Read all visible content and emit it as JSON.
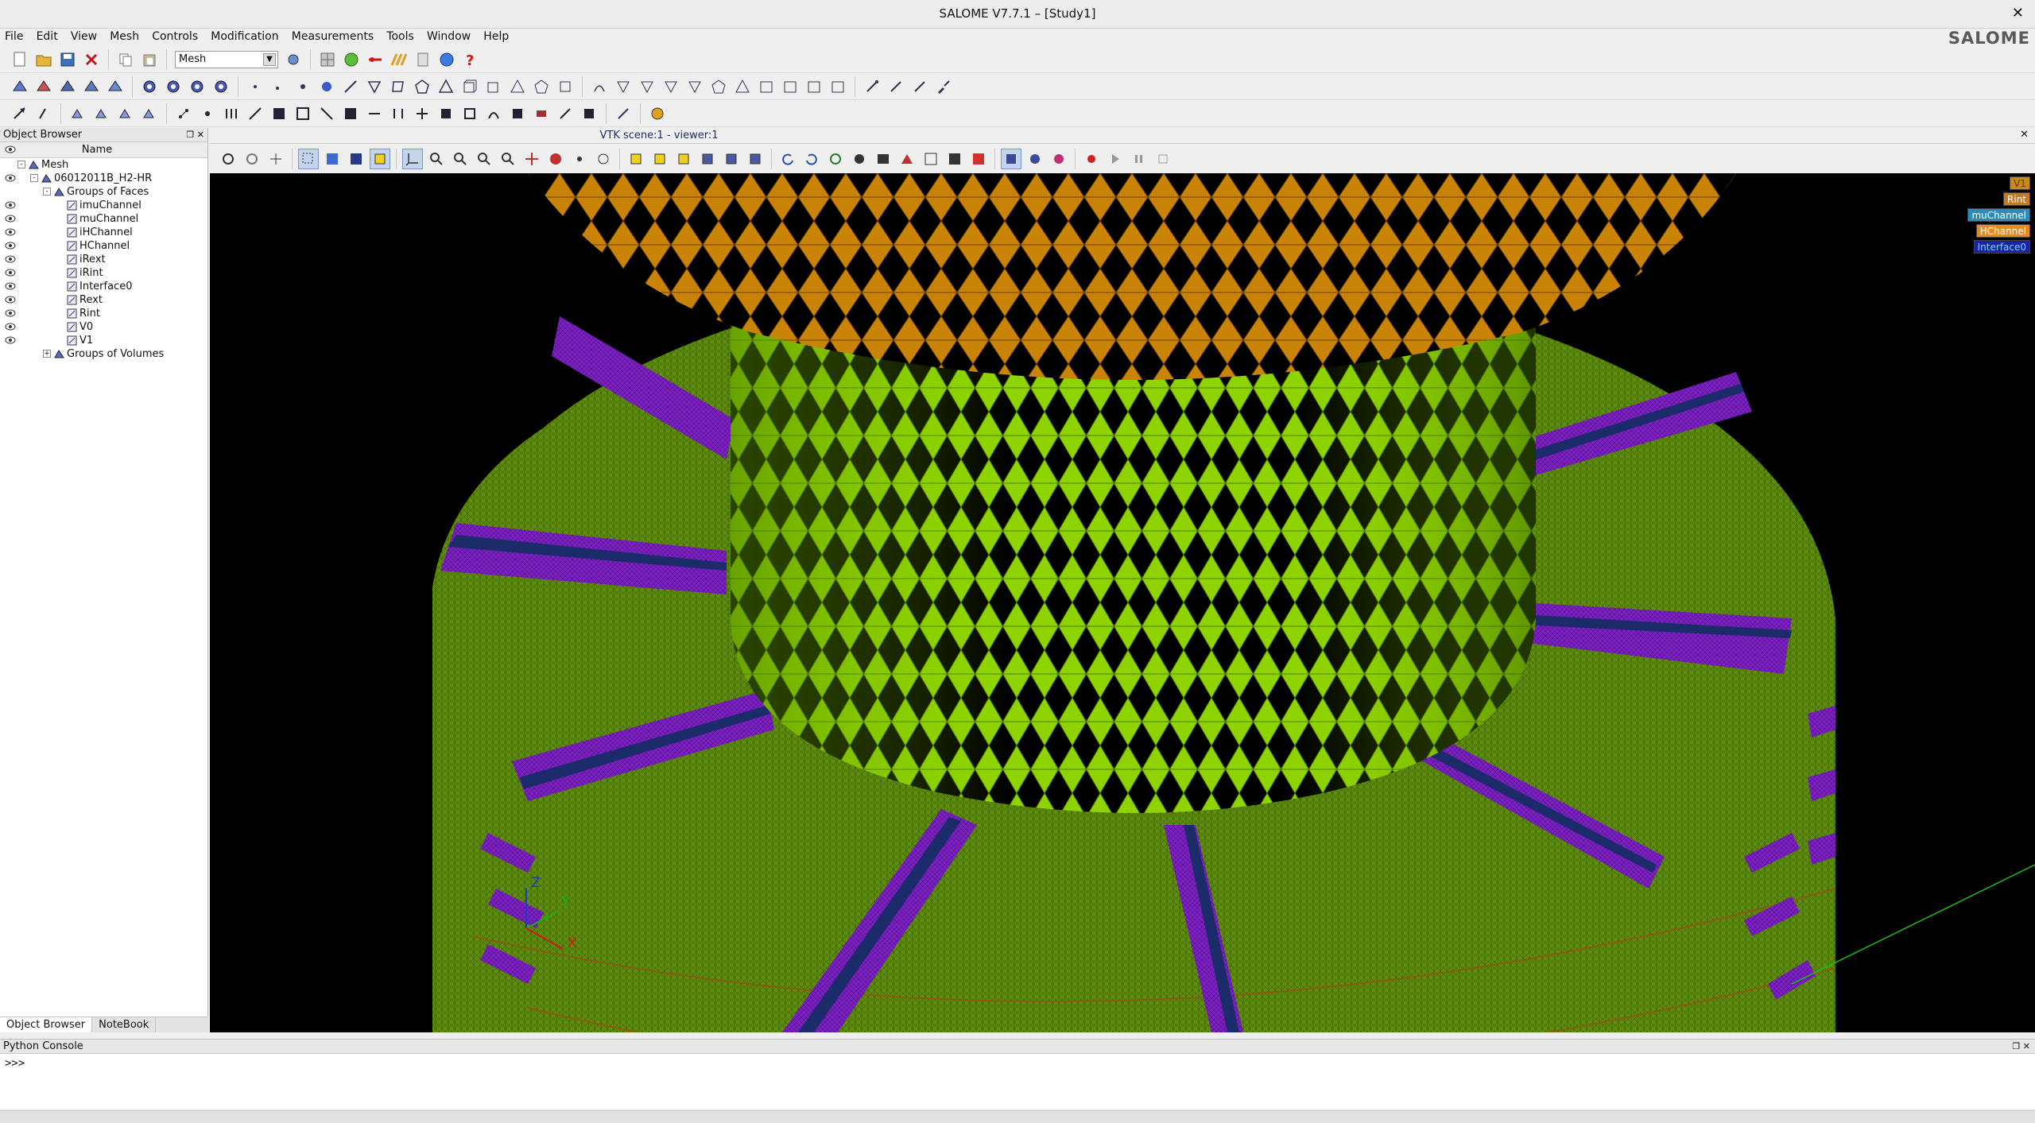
{
  "window": {
    "title": "SALOME  V7.7.1 – [Study1]",
    "close": "✕"
  },
  "menu": [
    "File",
    "Edit",
    "View",
    "Mesh",
    "Controls",
    "Modification",
    "Measurements",
    "Tools",
    "Window",
    "Help"
  ],
  "brand": "SALOME",
  "module_select": {
    "value": "Mesh"
  },
  "object_browser": {
    "title": "Object Browser",
    "column": "Name",
    "tree": [
      {
        "label": "Mesh",
        "level": 0,
        "expander": "-",
        "eye": false
      },
      {
        "label": "06012011B_H2-HR",
        "level": 1,
        "expander": "-",
        "eye": true
      },
      {
        "label": "Groups of Faces",
        "level": 2,
        "expander": "-",
        "eye": false
      },
      {
        "label": "imuChannel",
        "level": 3,
        "eye": true
      },
      {
        "label": "muChannel",
        "level": 3,
        "eye": true
      },
      {
        "label": "iHChannel",
        "level": 3,
        "eye": true
      },
      {
        "label": "HChannel",
        "level": 3,
        "eye": true
      },
      {
        "label": "iRext",
        "level": 3,
        "eye": true
      },
      {
        "label": "iRint",
        "level": 3,
        "eye": true
      },
      {
        "label": "Interface0",
        "level": 3,
        "eye": true
      },
      {
        "label": "Rext",
        "level": 3,
        "eye": true
      },
      {
        "label": "Rint",
        "level": 3,
        "eye": true
      },
      {
        "label": "V0",
        "level": 3,
        "eye": true
      },
      {
        "label": "V1",
        "level": 3,
        "eye": true
      },
      {
        "label": "Groups of Volumes",
        "level": 2,
        "expander": "+",
        "eye": false
      }
    ],
    "tabs": [
      "Object Browser",
      "NoteBook"
    ]
  },
  "viewer": {
    "title": "VTK scene:1 - viewer:1",
    "legend": [
      {
        "label": "V1",
        "bg": "#c78a17",
        "fg": "#5a3a00"
      },
      {
        "label": "Rint",
        "bg": "#c97a1c",
        "fg": "#ffffff"
      },
      {
        "label": "muChannel",
        "bg": "#2c8bbd",
        "fg": "#ffffff"
      },
      {
        "label": "HChannel",
        "bg": "#e88b1b",
        "fg": "#ffffff"
      },
      {
        "label": "Interface0",
        "bg": "#1a22a8",
        "fg": "#7ad2ff"
      }
    ],
    "axes": {
      "z": "Z",
      "y": "Y",
      "x": "X"
    }
  },
  "python_console": {
    "title": "Python Console",
    "prompt": ">>>"
  },
  "colors": {
    "mesh_green": "#5f8f0a",
    "cylinder_green": "#8fd400",
    "cap_orange": "#c98408",
    "channel_purple": "#7a1fc0",
    "channel_navy": "#1c2c6a"
  }
}
